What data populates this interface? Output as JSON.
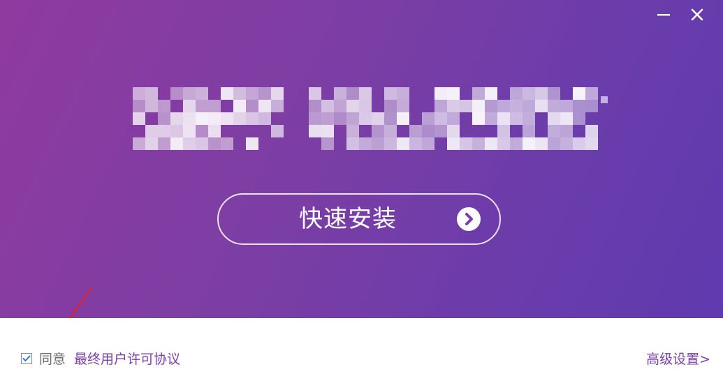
{
  "window": {
    "minimize_icon": "minimize-icon",
    "close_icon": "close-icon"
  },
  "hero": {
    "logo": "pixelated-product-logo",
    "install_button_label": "快速安装",
    "install_button_icon": "chevron-right-circle-icon"
  },
  "footer": {
    "agree_checked": true,
    "agree_label": "同意",
    "eula_link": "最终用户许可协议",
    "advanced_settings_link": "高级设置>"
  },
  "colors": {
    "gradient_start": "#8f3a9f",
    "gradient_end": "#5f3aae",
    "link": "#7b3fb0",
    "annotation_arrow": "#e0202a"
  }
}
